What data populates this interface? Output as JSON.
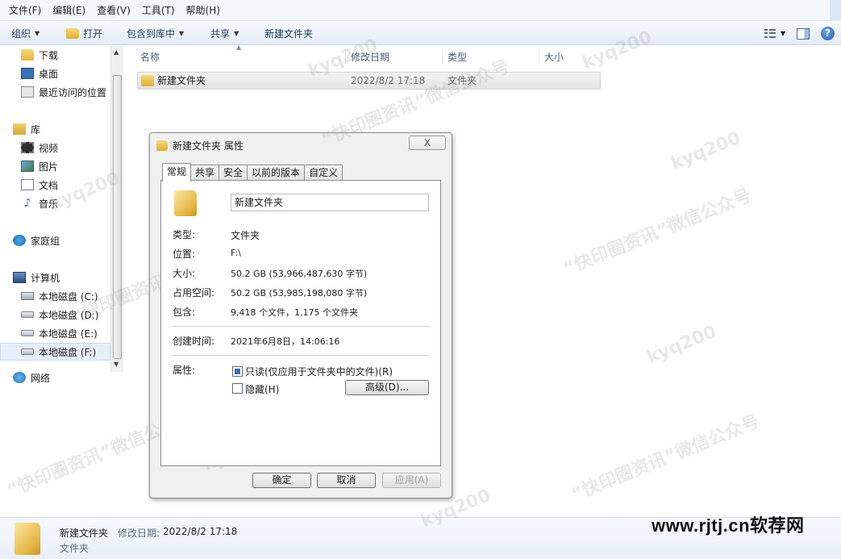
{
  "menu": {
    "items": [
      "文件(F)",
      "编辑(E)",
      "查看(V)",
      "工具(T)",
      "帮助(H)"
    ]
  },
  "toolbar": {
    "organize": "组织",
    "open": "打开",
    "include_library": "包含到库中",
    "share": "共享",
    "new_folder": "新建文件夹"
  },
  "nav": {
    "downloads": "下载",
    "desktop": "桌面",
    "recent": "最近访问的位置",
    "library": "库",
    "video": "视频",
    "pictures": "图片",
    "documents": "文档",
    "music": "音乐",
    "homegroup": "家庭组",
    "computer": "计算机",
    "disk_c": "本地磁盘 (C:)",
    "disk_d": "本地磁盘 (D:)",
    "disk_e": "本地磁盘 (E:)",
    "disk_f": "本地磁盘 (F:)",
    "network": "网络"
  },
  "columns": {
    "name": "名称",
    "modified": "修改日期",
    "type": "类型",
    "size": "大小"
  },
  "files": [
    {
      "name": "新建文件夹",
      "modified": "2022/8/2 17:18",
      "type": "文件夹"
    }
  ],
  "dialog": {
    "title": "新建文件夹 属性",
    "close": "X",
    "tabs": [
      "常规",
      "共享",
      "安全",
      "以前的版本",
      "自定义"
    ],
    "folder_name": "新建文件夹",
    "type_label": "类型:",
    "type_value": "文件夹",
    "location_label": "位置:",
    "location_value": "F:\\",
    "size_label": "大小:",
    "size_value": "50.2 GB (53,966,487,630 字节)",
    "disk_size_label": "占用空间:",
    "disk_size_value": "50.2 GB (53,985,198,080 字节)",
    "contains_label": "包含:",
    "contains_value": "9,418 个文件，1,175 个文件夹",
    "created_label": "创建时间:",
    "created_value": "2021年6月8日，14:06:16",
    "attributes_label": "属性:",
    "readonly_label": "只读(仅应用于文件夹中的文件)(R)",
    "hidden_label": "隐藏(H)",
    "advanced_button": "高级(D)...",
    "ok_button": "确定",
    "cancel_button": "取消",
    "apply_button": "应用(A)"
  },
  "details": {
    "name": "新建文件夹",
    "modified_label": "修改日期:",
    "modified_value": "2022/8/2 17:18",
    "type": "文件夹"
  },
  "watermark": {
    "text_a": "kyq200",
    "text_b": "“快印圈资讯”微信公众号",
    "site": "www.rjtj.cn软荐网"
  },
  "colors": {
    "toolbar_bg": "#e3ebf6",
    "selection": "#e5eef9",
    "folder": "#e4b644"
  }
}
